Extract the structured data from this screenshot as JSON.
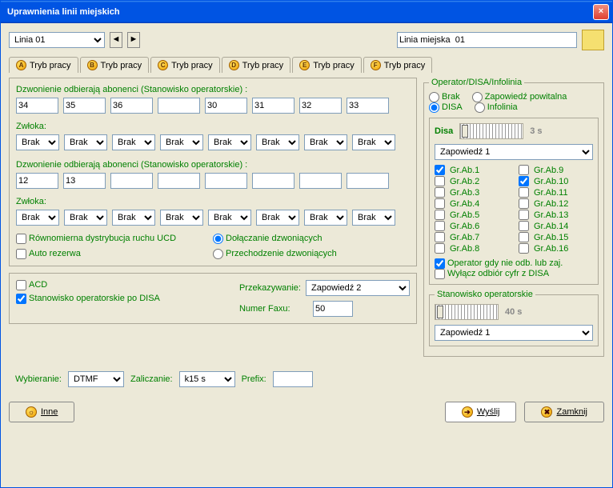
{
  "title": "Uprawnienia linii miejskich",
  "lineSelect": "Linia 01",
  "lineName": "Linia miejska  01",
  "tabs": [
    "Tryb pracy",
    "Tryb pracy",
    "Tryb pracy",
    "Tryb pracy",
    "Tryb pracy",
    "Tryb pracy"
  ],
  "tabLetters": [
    "A",
    "B",
    "C",
    "D",
    "E",
    "F"
  ],
  "sec1Label": "Dzwonienie odbierają abonenci (Stanowisko operatorskie) :",
  "zwlokaLabel": "Zwłoka:",
  "row1": [
    "34",
    "35",
    "36",
    "",
    "30",
    "31",
    "32",
    "33"
  ],
  "zw1": [
    "Brak",
    "Brak",
    "Brak",
    "Brak",
    "Brak",
    "Brak",
    "Brak",
    "Brak"
  ],
  "row2": [
    "12",
    "13",
    "",
    "",
    "",
    "",
    "",
    ""
  ],
  "zw2": [
    "Brak",
    "Brak",
    "Brak",
    "Brak",
    "Brak",
    "Brak",
    "Brak",
    "Brak"
  ],
  "chkUCD": "Równomierna dystrybucja ruchu UCD",
  "chkAuto": "Auto rezerwa",
  "radDolacz": "Dołączanie dzwoniących",
  "radPrzech": "Przechodzenie dzwoniących",
  "chkACD": "ACD",
  "chkStanPoDisa": "Stanowisko operatorskie po DISA",
  "przekazLabel": "Przekazywanie:",
  "przekazVal": "Zapowiedź 2",
  "faxLabel": "Numer Faxu:",
  "faxVal": "50",
  "opLegend": "Operator/DISA/Infolinia",
  "radBrak": "Brak",
  "radZapow": "Zapowiedź powitalna",
  "radDisa": "DISA",
  "radInfo": "Infolinia",
  "disaLabel": "Disa",
  "disaTime": "3 s",
  "zapSel": "Zapowiedź 1",
  "grAb": [
    "Gr.Ab.1",
    "Gr.Ab.2",
    "Gr.Ab.3",
    "Gr.Ab.4",
    "Gr.Ab.5",
    "Gr.Ab.6",
    "Gr.Ab.7",
    "Gr.Ab.8",
    "Gr.Ab.9",
    "Gr.Ab.10",
    "Gr.Ab.11",
    "Gr.Ab.12",
    "Gr.Ab.13",
    "Gr.Ab.14",
    "Gr.Ab.15",
    "Gr.Ab.16"
  ],
  "chkOpGdy": "Operator gdy nie odb. lub zaj.",
  "chkWylacz": "Wyłącz odbiór cyfr z DISA",
  "stanLegend": "Stanowisko operatorskie",
  "stanTime": "40 s",
  "stanSel": "Zapowiedź 1",
  "wybLabel": "Wybieranie:",
  "wybVal": "DTMF",
  "zalLabel": "Zaliczanie:",
  "zalVal": "k15 s",
  "prefLabel": "Prefix:",
  "btnInne": "Inne",
  "btnWyslij": "Wyślij",
  "btnZamknij": "Zamknij"
}
